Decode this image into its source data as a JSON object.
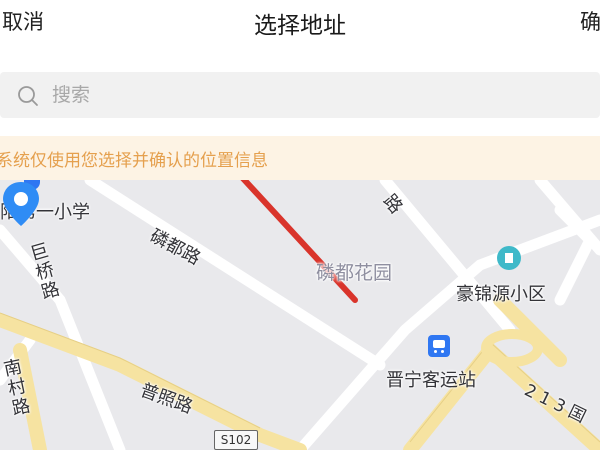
{
  "header": {
    "cancel_label": "取消",
    "title": "选择地址",
    "confirm_label": "确定"
  },
  "search": {
    "placeholder": "搜索"
  },
  "notice": {
    "text": "系统仅使用您选择并确认的位置信息"
  },
  "map": {
    "labels": {
      "school": "阳第一小学",
      "road_linlu": "磷都路",
      "road_juqiao": "巨桥路",
      "road_nancun": "南村路",
      "road_puzhao": "普照路",
      "road_top": "路",
      "garden": "磷都花园",
      "community": "豪锦源小区",
      "bus_station": "晋宁客运站",
      "route_shield": "S102",
      "route_213": "2 1 3 国"
    }
  },
  "colors": {
    "accent_blue": "#2f77f2",
    "notice_bg": "#fdf3e4",
    "notice_text": "#e5a04e",
    "arrow_red": "#d9342b",
    "major_road": "#f6e3a1"
  },
  "icons": {
    "search": "search-icon",
    "pin": "location-pin-icon",
    "bus": "bus-station-icon",
    "poi": "residential-poi-icon",
    "arrow": "red-arrow-annotation"
  }
}
